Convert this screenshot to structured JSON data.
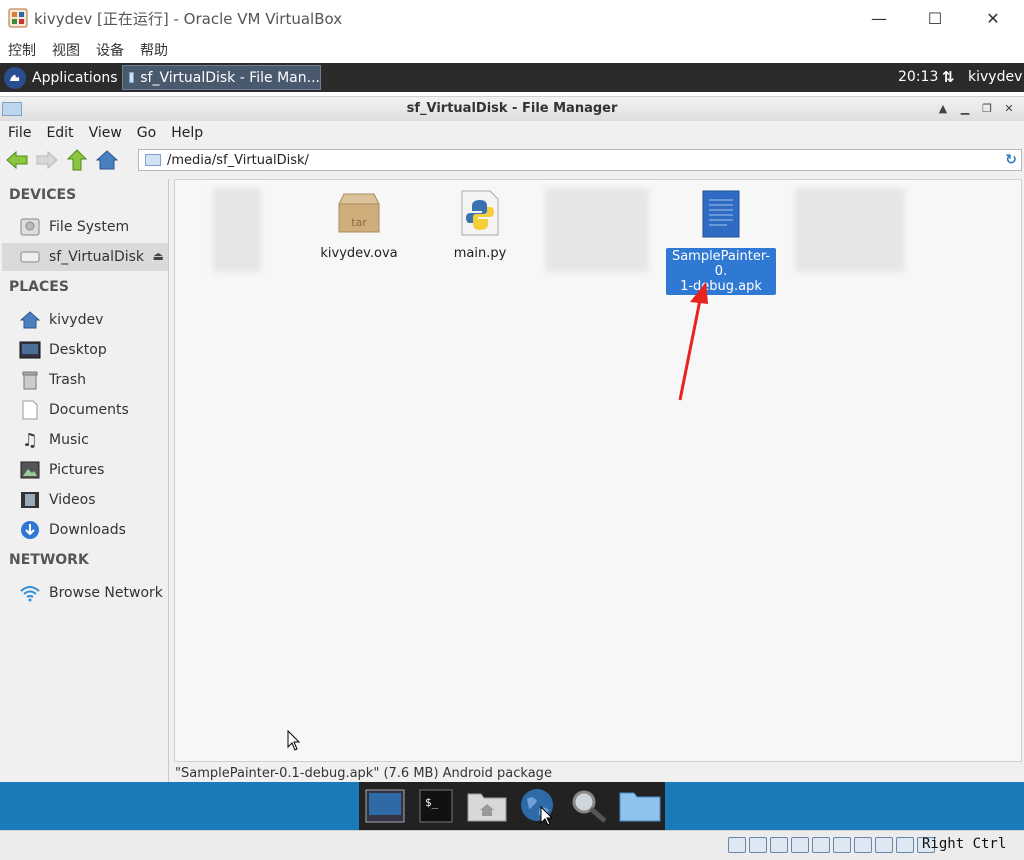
{
  "host": {
    "title": "kivydev [正在运行] - Oracle VM VirtualBox",
    "menu": [
      "控制",
      "视图",
      "设备",
      "帮助"
    ],
    "minimize": "—",
    "maximize": "☐",
    "close": "✕"
  },
  "panel": {
    "applications": "Applications",
    "task": "sf_VirtualDisk - File Man...",
    "clock": "20:13",
    "network_glyph": "⇅",
    "user": "kivydev"
  },
  "fm": {
    "title": "sf_VirtualDisk - File Manager",
    "menu": [
      "File",
      "Edit",
      "View",
      "Go",
      "Help"
    ],
    "path": "/media/sf_VirtualDisk/",
    "status": "\"SamplePainter-0.1-debug.apk\" (7.6 MB) Android package"
  },
  "sidebar": {
    "devices_header": "DEVICES",
    "places_header": "PLACES",
    "network_header": "NETWORK",
    "devices": [
      {
        "label": "File System",
        "icon": "harddisk-icon"
      },
      {
        "label": "sf_VirtualDisk",
        "icon": "drive-icon"
      }
    ],
    "places": [
      {
        "label": "kivydev",
        "icon": "home-icon"
      },
      {
        "label": "Desktop",
        "icon": "desktop-icon"
      },
      {
        "label": "Trash",
        "icon": "trash-icon"
      },
      {
        "label": "Documents",
        "icon": "documents-icon"
      },
      {
        "label": "Music",
        "icon": "music-icon"
      },
      {
        "label": "Pictures",
        "icon": "pictures-icon"
      },
      {
        "label": "Videos",
        "icon": "videos-icon"
      },
      {
        "label": "Downloads",
        "icon": "downloads-icon"
      }
    ],
    "network": [
      {
        "label": "Browse Network",
        "icon": "wifi-icon"
      }
    ]
  },
  "files": [
    {
      "name": "kivydev.ova",
      "icon": "archive-icon",
      "icon_text": "tar"
    },
    {
      "name": "main.py",
      "icon": "python-icon"
    },
    {
      "name": "SamplePainter-0.1-debug.apk",
      "name_line1": "SamplePainter-0.",
      "name_line2": "1-debug.apk",
      "icon": "document-icon",
      "selected": true
    }
  ],
  "vbox_status": {
    "host_key": "Right Ctrl"
  },
  "colors": {
    "selection": "#2f78d3",
    "panel": "#2b2b2b",
    "desktop": "#1b7ab8",
    "annotation_arrow": "#e8231f"
  }
}
